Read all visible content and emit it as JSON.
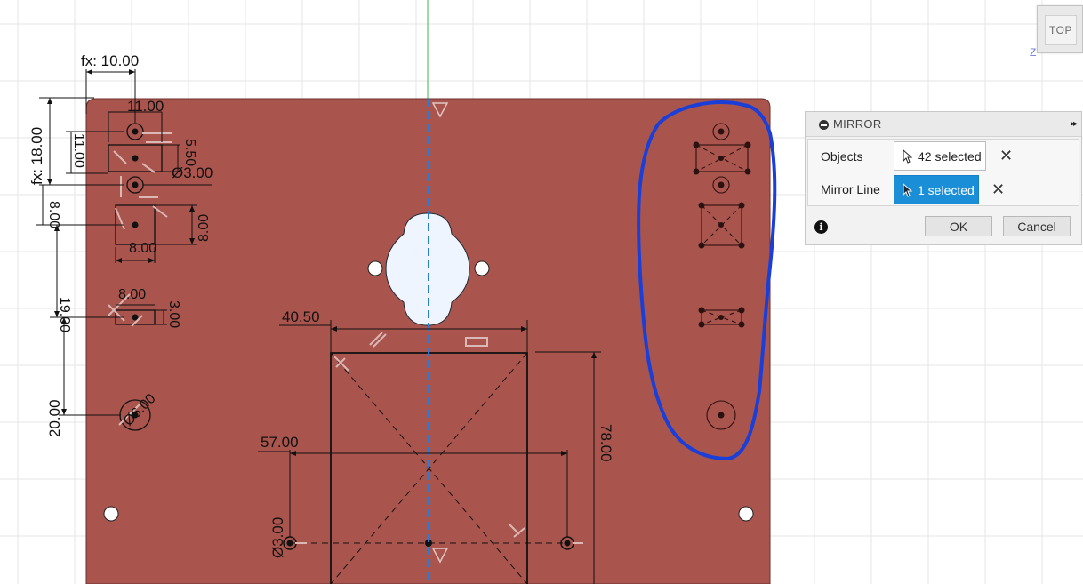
{
  "viewcube": {
    "face_label": "TOP",
    "axis_label": "Z"
  },
  "sketch": {
    "dimensions": {
      "fx_width": "fx: 10.00",
      "fx_height": "fx: 18.00",
      "w_11_h": "11.00",
      "w_11_v": "11.00",
      "d_5_50": "5.50",
      "d_dia3_top": "Ø3.00",
      "d_8_v_left": "8.00",
      "d_8_v_right": "8.00",
      "d_8_h_a": "8.00",
      "d_8_h_b": "8.00",
      "d_3_00": "3.00",
      "d_19": "19.00",
      "d_20": "20.00",
      "d_dia6": "Ø6.00",
      "d_40_50": "40.50",
      "d_57": "57.00",
      "d_78": "78.00",
      "d_dia3_bottom": "Ø3.00"
    }
  },
  "colors": {
    "plate_fill": "#a9544d",
    "plate_stroke": "#6e2f2a",
    "mirror_line": "#2a7bd6",
    "annotation": "#1a3fd8",
    "dim_line": "#111111",
    "grid": "#e6e6e6",
    "green_axis": "#3bb54a"
  },
  "mirror_dialog": {
    "title": "MIRROR",
    "objects_label": "Objects",
    "objects_value": "42 selected",
    "mirror_line_label": "Mirror Line",
    "mirror_line_value": "1 selected",
    "ok_label": "OK",
    "cancel_label": "Cancel",
    "expand_icon": "▸▸",
    "clear_icon": "✕",
    "info_icon": "i"
  }
}
